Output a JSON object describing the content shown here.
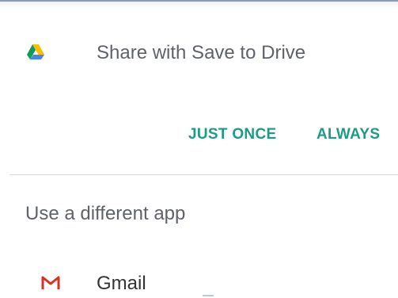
{
  "share_dialog": {
    "title": "Share with Save to Drive",
    "app_icon": "google-drive-icon"
  },
  "actions": {
    "just_once_label": "JUST ONCE",
    "always_label": "ALWAYS",
    "accent_color": "#1f9a86"
  },
  "other_apps": {
    "section_label": "Use a different app",
    "items": [
      {
        "label": "Gmail",
        "icon": "gmail-icon"
      }
    ]
  }
}
